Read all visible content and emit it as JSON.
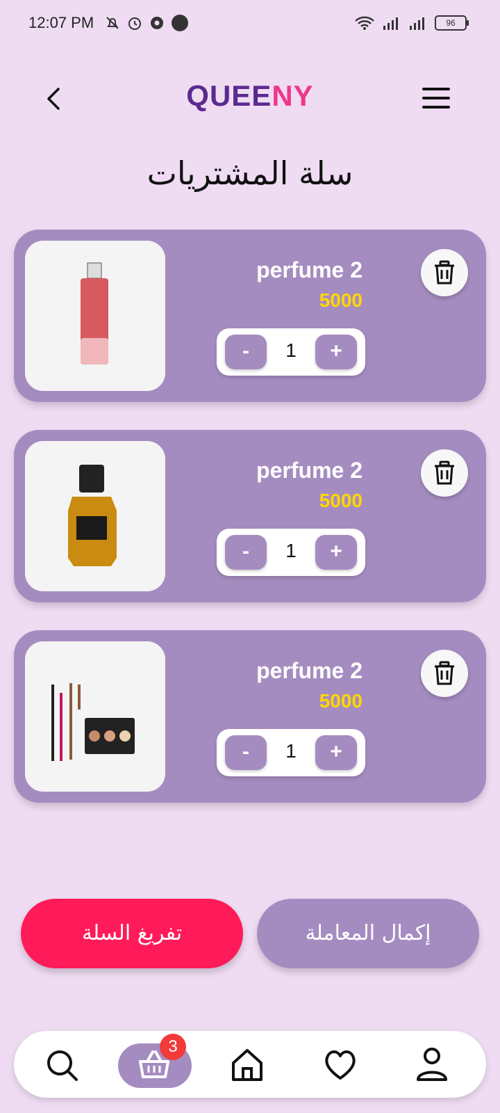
{
  "status_bar": {
    "time": "12:07 PM",
    "battery": "96",
    "icons": [
      "mute-icon",
      "alarm-icon",
      "settings-icon",
      "app-365-icon",
      "wifi-icon",
      "signal-icon",
      "signal-icon-2",
      "battery-icon"
    ]
  },
  "header": {
    "logo_part1": "QUEE",
    "logo_part2": "NY"
  },
  "page": {
    "title": "سلة المشتريات"
  },
  "cart": {
    "items": [
      {
        "name": "perfume 2",
        "price": "5000",
        "qty": "1",
        "minus": "-",
        "plus": "+",
        "image": "red-perfume-bottle"
      },
      {
        "name": "perfume 2",
        "price": "5000",
        "qty": "1",
        "minus": "-",
        "plus": "+",
        "image": "amber-perfume-bottle"
      },
      {
        "name": "perfume 2",
        "price": "5000",
        "qty": "1",
        "minus": "-",
        "plus": "+",
        "image": "makeup-palette-and-pencils"
      }
    ]
  },
  "actions": {
    "empty_cart": "تفريغ السلة",
    "checkout": "إكمال المعاملة"
  },
  "nav": {
    "cart_badge": "3",
    "items": [
      "search-icon",
      "cart-basket-icon",
      "home-icon",
      "heart-icon",
      "profile-icon"
    ]
  },
  "colors": {
    "background": "#efdcf3",
    "card": "#a58cc0",
    "price": "#ffd600",
    "danger": "#ff1a5a",
    "logo_purple": "#5b2a8f",
    "logo_pink": "#f0378a"
  }
}
